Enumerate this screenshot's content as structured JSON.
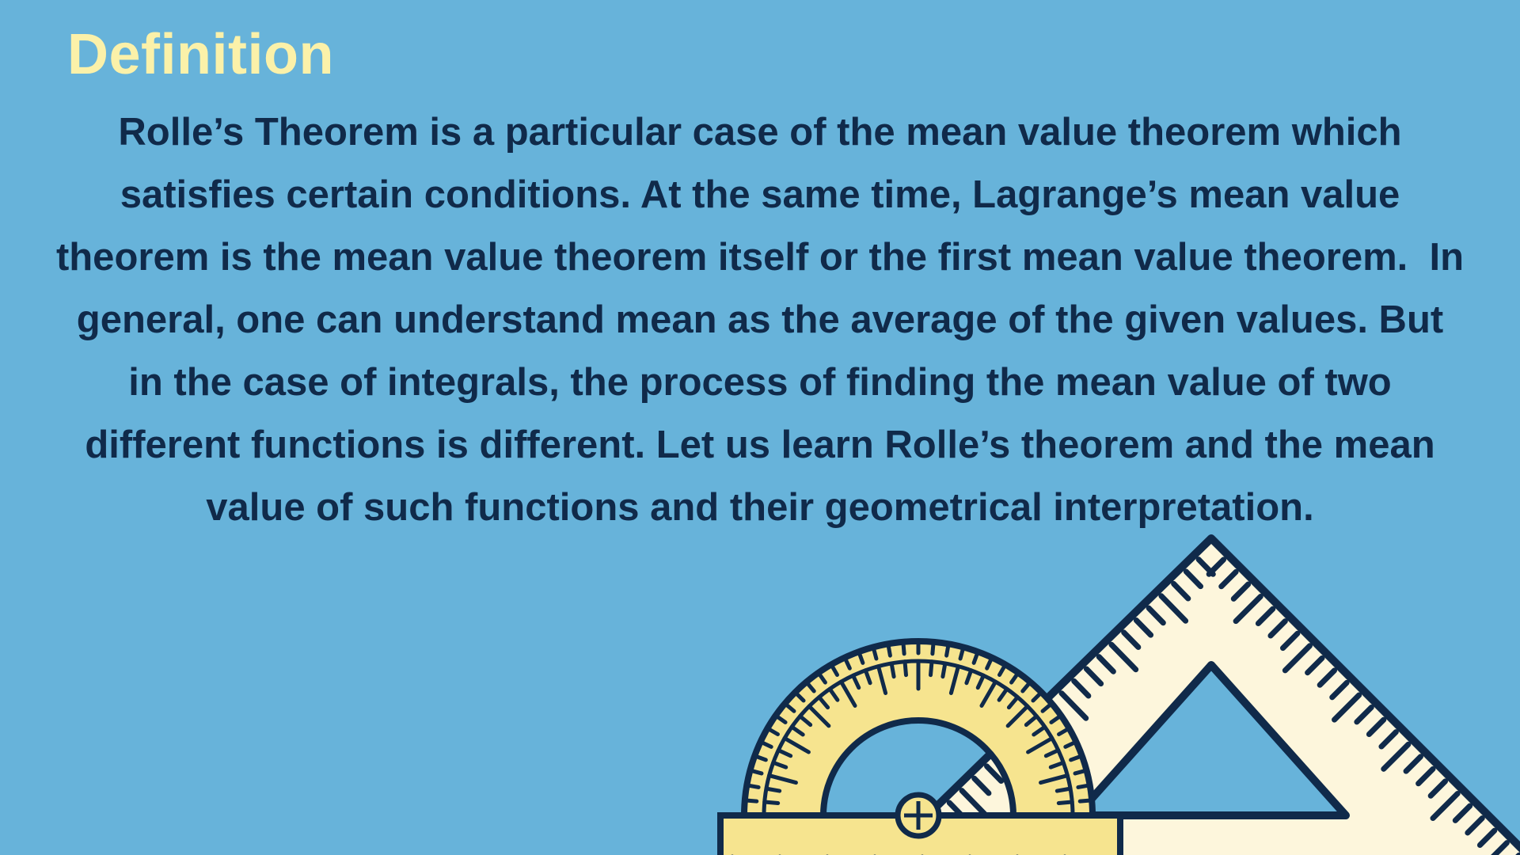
{
  "slide": {
    "title": "Definition",
    "body": "Rolle’s Theorem is a particular case of the mean value theorem which satisfies certain conditions. At the same time, Lagrange’s mean value theorem is the mean value theorem itself or the first mean value theorem.  In general, one can understand mean as the average of the given values. But in the case of integrals, the process of finding the mean value of two different functions is different. Let us learn Rolle’s theorem and the mean value of such functions and their geometrical interpretation."
  },
  "illustration": {
    "items": [
      "protractor",
      "set-square-ruler"
    ]
  },
  "colors": {
    "background": "#67b3da",
    "title": "#fbf1a9",
    "body_text": "#102a4a",
    "protractor_fill": "#f6e48f",
    "set_square_fill": "#fdf6dc",
    "outline": "#102a4a"
  }
}
